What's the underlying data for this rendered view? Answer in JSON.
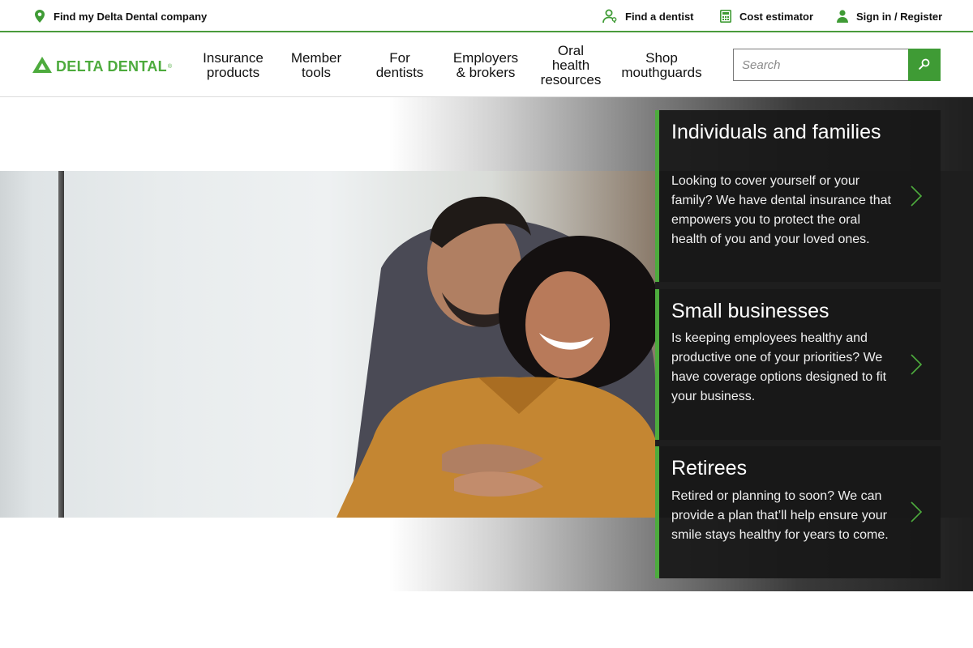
{
  "utility": {
    "find_company": "Find my Delta Dental company",
    "find_dentist": "Find a dentist",
    "cost_estimator": "Cost estimator",
    "sign_in": "Sign in / Register"
  },
  "header": {
    "logo_text": "DELTA DENTAL",
    "logo_reg": "®",
    "nav": [
      {
        "label": "Insurance\nproducts"
      },
      {
        "label": "Member\ntools"
      },
      {
        "label": "For\ndentists"
      },
      {
        "label": "Employers\n& brokers"
      },
      {
        "label": "Oral\nhealth\nresources"
      },
      {
        "label": "Shop\nmouthguards"
      }
    ],
    "search_placeholder": "Search"
  },
  "hero": {
    "cards": [
      {
        "title": "Individuals and families",
        "body": "Looking to cover yourself or your family? We have dental insurance that empowers you to protect the oral health of you and your loved ones."
      },
      {
        "title": "Small businesses",
        "body": "Is keeping employees healthy and productive one of your priorities? We have coverage options designed to fit your business."
      },
      {
        "title": "Retirees",
        "body": "Retired or planning to soon? We can provide a plan that’ll help ensure your smile stays healthy for years to come."
      }
    ]
  },
  "colors": {
    "brand_green": "#4dab3d",
    "card_bg": "#181818"
  }
}
